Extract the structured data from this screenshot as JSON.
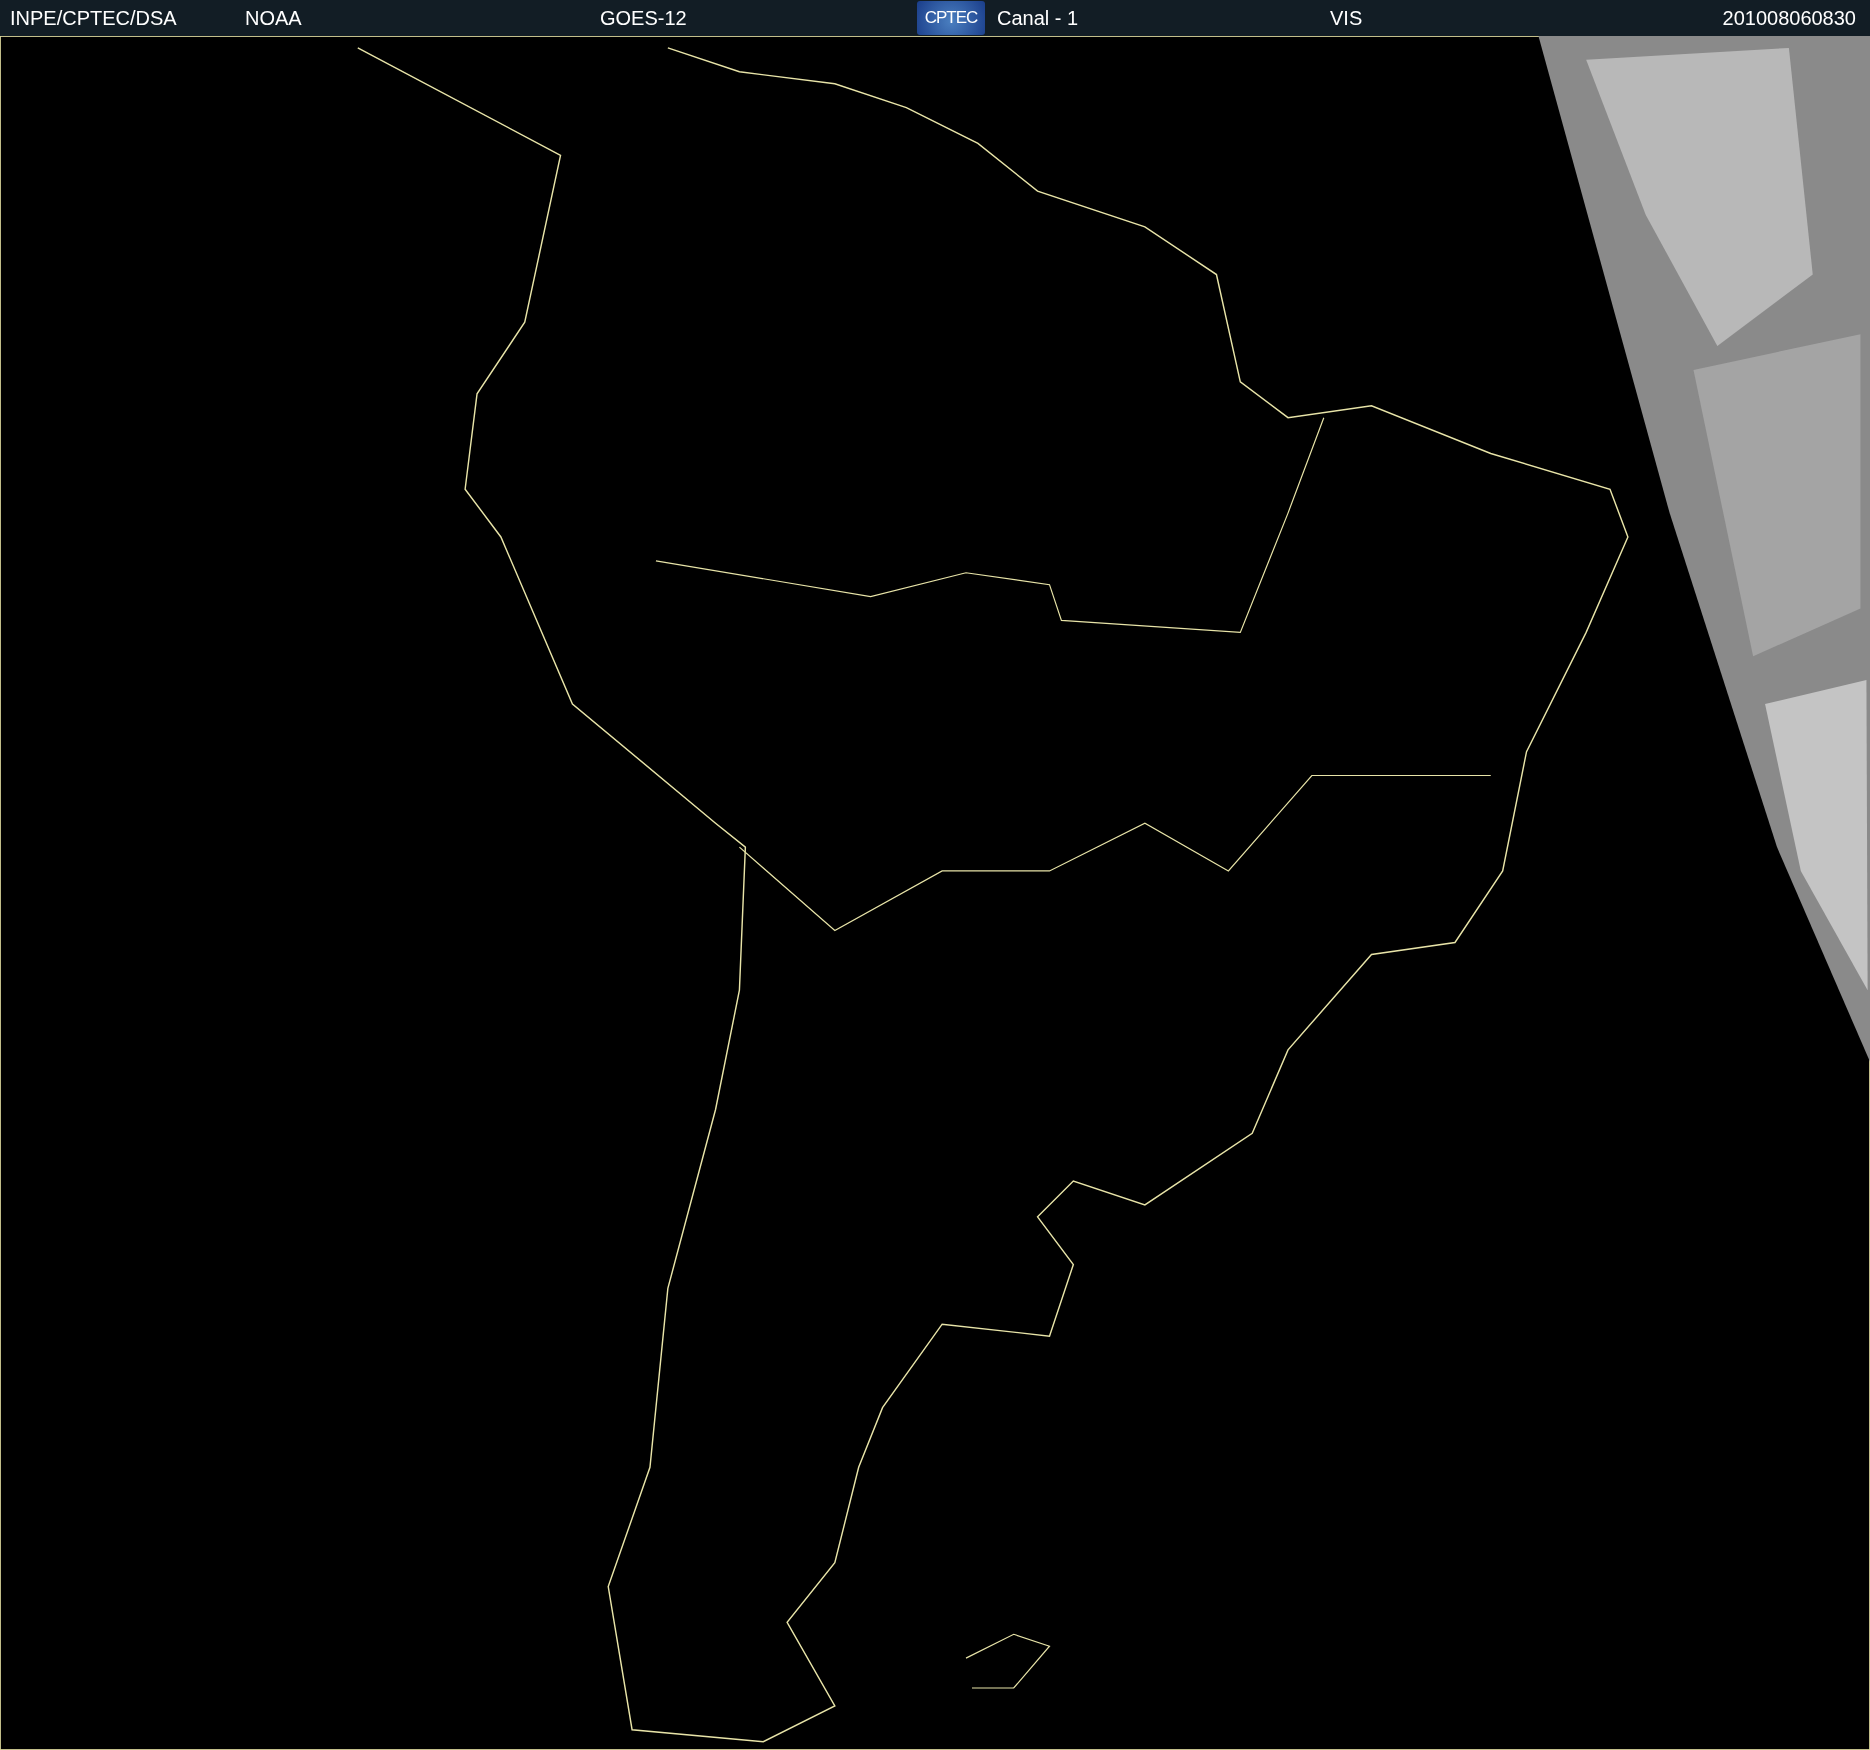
{
  "header": {
    "items": [
      {
        "kind": "text",
        "text": "INPE/CPTEC/DSA"
      },
      {
        "kind": "text",
        "text": "NOAA"
      },
      {
        "kind": "text",
        "text": "GOES-12"
      },
      {
        "kind": "logo",
        "text": "CPTEC"
      },
      {
        "kind": "text",
        "text": "Canal - 1"
      },
      {
        "kind": "text",
        "text": "VIS"
      },
      {
        "kind": "text",
        "text": "201008060830"
      }
    ]
  }
}
